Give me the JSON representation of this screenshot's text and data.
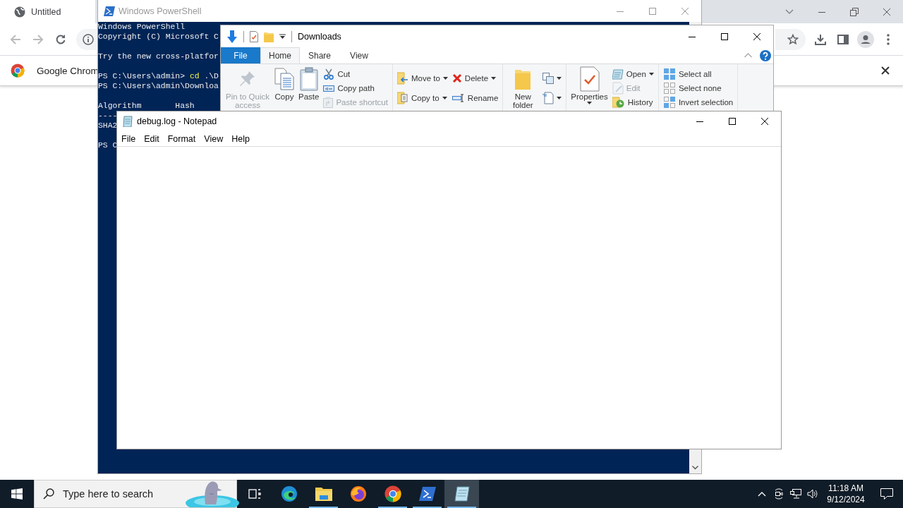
{
  "browser": {
    "tab": {
      "title": "Untitled",
      "selected": true
    },
    "infobar": {
      "text": "Google Chrom"
    }
  },
  "powershell": {
    "title": "Windows PowerShell",
    "blocks": [
      [
        {
          "segments": [
            {
              "text": "Windows PowerShell",
              "kind": "output"
            }
          ]
        },
        {
          "segments": [
            {
              "text": "Copyright (C) Microsoft C",
              "kind": "output"
            }
          ]
        }
      ],
      [
        {
          "segments": [
            {
              "text": "Try the new cross-platfor",
              "kind": "output"
            }
          ]
        }
      ],
      [
        {
          "segments": [
            {
              "text": "PS C:\\Users\\admin> ",
              "kind": "output"
            },
            {
              "text": "cd",
              "kind": "command"
            },
            {
              "text": " .\\D",
              "kind": "output"
            }
          ]
        },
        {
          "segments": [
            {
              "text": "PS C:\\Users\\admin\\Downloa",
              "kind": "output"
            }
          ]
        }
      ],
      [
        {
          "segments": [
            {
              "text": "Algorithm       Hash",
              "kind": "output"
            }
          ]
        },
        {
          "segments": [
            {
              "text": "----",
              "kind": "output"
            }
          ]
        },
        {
          "segments": [
            {
              "text": "SHA2",
              "kind": "output"
            }
          ]
        }
      ],
      [
        {
          "segments": [
            {
              "text": "PS C",
              "kind": "output"
            }
          ]
        }
      ]
    ]
  },
  "explorer": {
    "title": "Downloads",
    "tabs": [
      {
        "label": "File",
        "kind": "file",
        "selected": false
      },
      {
        "label": "Home",
        "kind": "tab",
        "selected": true
      },
      {
        "label": "Share",
        "kind": "tab",
        "selected": false
      },
      {
        "label": "View",
        "kind": "tab",
        "selected": false
      }
    ],
    "ribbon": [
      {
        "columns": [
          {
            "kind": "large",
            "items": [
              {
                "label": "Pin to Quick access",
                "disabled": true,
                "dropdown": false
              }
            ]
          },
          {
            "kind": "large",
            "items": [
              {
                "label": "Copy",
                "disabled": false,
                "dropdown": false
              }
            ]
          },
          {
            "kind": "large",
            "items": [
              {
                "label": "Paste",
                "disabled": false,
                "dropdown": false
              }
            ]
          },
          {
            "kind": "small",
            "items": [
              {
                "label": "Cut",
                "disabled": false,
                "dropdown": false
              },
              {
                "label": "Copy path",
                "disabled": false,
                "dropdown": false
              },
              {
                "label": "Paste shortcut",
                "disabled": true,
                "dropdown": false
              }
            ]
          }
        ]
      },
      {
        "columns": [
          {
            "kind": "small",
            "items": [
              {
                "label": "Move to",
                "disabled": false,
                "dropdown": true
              },
              {
                "label": "Copy to",
                "disabled": false,
                "dropdown": true
              }
            ]
          },
          {
            "kind": "small",
            "items": [
              {
                "label": "Delete",
                "disabled": false,
                "dropdown": true
              },
              {
                "label": "Rename",
                "disabled": false,
                "dropdown": false
              }
            ]
          }
        ]
      },
      {
        "columns": [
          {
            "kind": "large",
            "items": [
              {
                "label": "New folder",
                "disabled": false,
                "dropdown": false
              }
            ]
          },
          {
            "kind": "small",
            "items": [
              {
                "disabled": false,
                "dropdown": true
              },
              {
                "disabled": false,
                "dropdown": true
              }
            ]
          }
        ]
      },
      {
        "columns": [
          {
            "kind": "large",
            "items": [
              {
                "label": "Properties",
                "disabled": false,
                "dropdown": true
              }
            ]
          },
          {
            "kind": "small",
            "items": [
              {
                "label": "Open",
                "disabled": false,
                "dropdown": true
              },
              {
                "label": "Edit",
                "disabled": true,
                "dropdown": false
              },
              {
                "label": "History",
                "disabled": false,
                "dropdown": false
              }
            ]
          }
        ]
      },
      {
        "columns": [
          {
            "kind": "small",
            "items": [
              {
                "label": "Select all",
                "disabled": false,
                "dropdown": false
              },
              {
                "label": "Select none",
                "disabled": false,
                "dropdown": false
              },
              {
                "label": "Invert selection",
                "disabled": false,
                "dropdown": false
              }
            ]
          }
        ]
      }
    ]
  },
  "notepad": {
    "title": "debug.log - Notepad",
    "menu": [
      "File",
      "Edit",
      "Format",
      "View",
      "Help"
    ]
  },
  "taskbar": {
    "search": {
      "placeholder": "Type here to search"
    },
    "apps": [
      {
        "running": false,
        "active": false
      },
      {
        "running": true,
        "active": false
      },
      {
        "running": false,
        "active": false
      },
      {
        "running": true,
        "active": false
      },
      {
        "running": true,
        "active": false
      },
      {
        "running": true,
        "active": true
      }
    ],
    "clock": {
      "time": "11:18 AM",
      "date": "9/12/2024"
    }
  }
}
